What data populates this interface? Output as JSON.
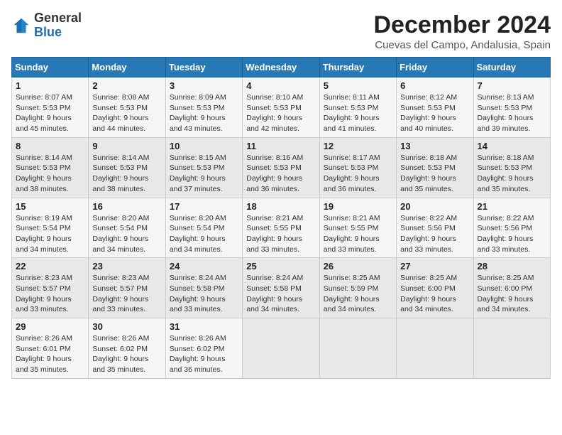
{
  "header": {
    "logo_general": "General",
    "logo_blue": "Blue",
    "month_year": "December 2024",
    "location": "Cuevas del Campo, Andalusia, Spain"
  },
  "calendar": {
    "days_of_week": [
      "Sunday",
      "Monday",
      "Tuesday",
      "Wednesday",
      "Thursday",
      "Friday",
      "Saturday"
    ],
    "weeks": [
      [
        null,
        null,
        null,
        null,
        null,
        null,
        null
      ]
    ]
  },
  "cells": [
    {
      "day": "1",
      "sunrise": "8:07 AM",
      "sunset": "5:53 PM",
      "daylight": "9 hours and 45 minutes."
    },
    {
      "day": "2",
      "sunrise": "8:08 AM",
      "sunset": "5:53 PM",
      "daylight": "9 hours and 44 minutes."
    },
    {
      "day": "3",
      "sunrise": "8:09 AM",
      "sunset": "5:53 PM",
      "daylight": "9 hours and 43 minutes."
    },
    {
      "day": "4",
      "sunrise": "8:10 AM",
      "sunset": "5:53 PM",
      "daylight": "9 hours and 42 minutes."
    },
    {
      "day": "5",
      "sunrise": "8:11 AM",
      "sunset": "5:53 PM",
      "daylight": "9 hours and 41 minutes."
    },
    {
      "day": "6",
      "sunrise": "8:12 AM",
      "sunset": "5:53 PM",
      "daylight": "9 hours and 40 minutes."
    },
    {
      "day": "7",
      "sunrise": "8:13 AM",
      "sunset": "5:53 PM",
      "daylight": "9 hours and 39 minutes."
    },
    {
      "day": "8",
      "sunrise": "8:14 AM",
      "sunset": "5:53 PM",
      "daylight": "9 hours and 38 minutes."
    },
    {
      "day": "9",
      "sunrise": "8:14 AM",
      "sunset": "5:53 PM",
      "daylight": "9 hours and 38 minutes."
    },
    {
      "day": "10",
      "sunrise": "8:15 AM",
      "sunset": "5:53 PM",
      "daylight": "9 hours and 37 minutes."
    },
    {
      "day": "11",
      "sunrise": "8:16 AM",
      "sunset": "5:53 PM",
      "daylight": "9 hours and 36 minutes."
    },
    {
      "day": "12",
      "sunrise": "8:17 AM",
      "sunset": "5:53 PM",
      "daylight": "9 hours and 36 minutes."
    },
    {
      "day": "13",
      "sunrise": "8:18 AM",
      "sunset": "5:53 PM",
      "daylight": "9 hours and 35 minutes."
    },
    {
      "day": "14",
      "sunrise": "8:18 AM",
      "sunset": "5:53 PM",
      "daylight": "9 hours and 35 minutes."
    },
    {
      "day": "15",
      "sunrise": "8:19 AM",
      "sunset": "5:54 PM",
      "daylight": "9 hours and 34 minutes."
    },
    {
      "day": "16",
      "sunrise": "8:20 AM",
      "sunset": "5:54 PM",
      "daylight": "9 hours and 34 minutes."
    },
    {
      "day": "17",
      "sunrise": "8:20 AM",
      "sunset": "5:54 PM",
      "daylight": "9 hours and 34 minutes."
    },
    {
      "day": "18",
      "sunrise": "8:21 AM",
      "sunset": "5:55 PM",
      "daylight": "9 hours and 33 minutes."
    },
    {
      "day": "19",
      "sunrise": "8:21 AM",
      "sunset": "5:55 PM",
      "daylight": "9 hours and 33 minutes."
    },
    {
      "day": "20",
      "sunrise": "8:22 AM",
      "sunset": "5:56 PM",
      "daylight": "9 hours and 33 minutes."
    },
    {
      "day": "21",
      "sunrise": "8:22 AM",
      "sunset": "5:56 PM",
      "daylight": "9 hours and 33 minutes."
    },
    {
      "day": "22",
      "sunrise": "8:23 AM",
      "sunset": "5:57 PM",
      "daylight": "9 hours and 33 minutes."
    },
    {
      "day": "23",
      "sunrise": "8:23 AM",
      "sunset": "5:57 PM",
      "daylight": "9 hours and 33 minutes."
    },
    {
      "day": "24",
      "sunrise": "8:24 AM",
      "sunset": "5:58 PM",
      "daylight": "9 hours and 33 minutes."
    },
    {
      "day": "25",
      "sunrise": "8:24 AM",
      "sunset": "5:58 PM",
      "daylight": "9 hours and 34 minutes."
    },
    {
      "day": "26",
      "sunrise": "8:25 AM",
      "sunset": "5:59 PM",
      "daylight": "9 hours and 34 minutes."
    },
    {
      "day": "27",
      "sunrise": "8:25 AM",
      "sunset": "6:00 PM",
      "daylight": "9 hours and 34 minutes."
    },
    {
      "day": "28",
      "sunrise": "8:25 AM",
      "sunset": "6:00 PM",
      "daylight": "9 hours and 34 minutes."
    },
    {
      "day": "29",
      "sunrise": "8:26 AM",
      "sunset": "6:01 PM",
      "daylight": "9 hours and 35 minutes."
    },
    {
      "day": "30",
      "sunrise": "8:26 AM",
      "sunset": "6:02 PM",
      "daylight": "9 hours and 35 minutes."
    },
    {
      "day": "31",
      "sunrise": "8:26 AM",
      "sunset": "6:02 PM",
      "daylight": "9 hours and 36 minutes."
    }
  ],
  "week_start_day": 0
}
